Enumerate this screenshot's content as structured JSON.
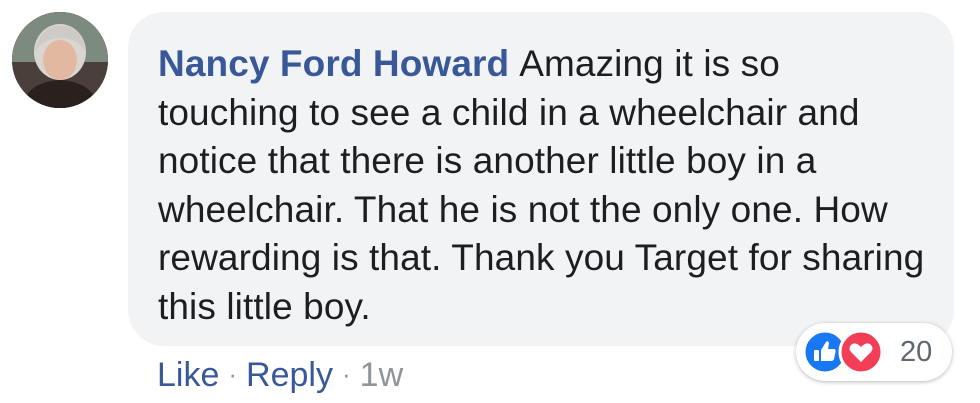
{
  "comment": {
    "author": "Nancy Ford Howard",
    "text": "Amazing it is so touching to see a child in a wheelchair and notice that there is another little boy in a wheelchair. That he is not the only one. How rewarding is that. Thank you Target for sharing this little boy."
  },
  "reactions": {
    "icons": [
      "like-icon",
      "love-icon"
    ],
    "count": "20"
  },
  "actions": {
    "like_label": "Like",
    "reply_label": "Reply",
    "separator": "·",
    "timestamp": "1w"
  },
  "colors": {
    "author_link": "#385898",
    "bubble_bg": "#f2f3f5",
    "like_blue": "#1877f2",
    "love_red": "#f33e58",
    "meta_gray": "#90949c"
  }
}
